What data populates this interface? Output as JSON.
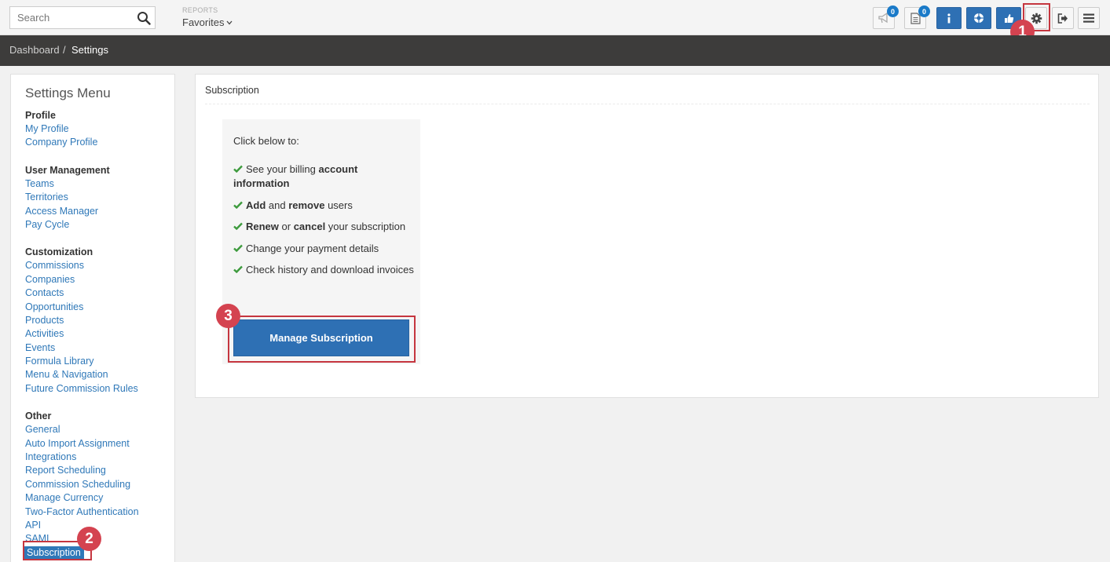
{
  "topbar": {
    "search_placeholder": "Search",
    "reports_label": "REPORTS",
    "favorites_label": "Favorites",
    "announcements_badge": "0",
    "documents_badge": "0"
  },
  "breadcrumb": {
    "items": [
      "Dashboard",
      "Settings"
    ],
    "separator": "/"
  },
  "sidebar": {
    "title": "Settings Menu",
    "sections": [
      {
        "heading": "Profile",
        "items": [
          "My Profile",
          "Company Profile"
        ]
      },
      {
        "heading": "User Management",
        "items": [
          "Teams",
          "Territories",
          "Access Manager",
          "Pay Cycle"
        ]
      },
      {
        "heading": "Customization",
        "items": [
          "Commissions",
          "Companies",
          "Contacts",
          "Opportunities",
          "Products",
          "Activities",
          "Events",
          "Formula Library",
          "Menu & Navigation",
          "Future Commission Rules"
        ]
      },
      {
        "heading": "Other",
        "items": [
          "General",
          "Auto Import Assignment",
          "Integrations",
          "Report Scheduling",
          "Commission Scheduling",
          "Manage Currency",
          "Two-Factor Authentication",
          "API",
          "SAML",
          "Subscription"
        ]
      }
    ],
    "active_item": "Subscription"
  },
  "main": {
    "panel_title": "Subscription",
    "intro": "Click below to:",
    "bullets": [
      {
        "pre": "See your billing ",
        "b1": "account information",
        "mid": "",
        "b2": "",
        "post": ""
      },
      {
        "pre": "",
        "b1": "Add",
        "mid": " and ",
        "b2": "remove",
        "post": " users"
      },
      {
        "pre": "",
        "b1": "Renew",
        "mid": " or ",
        "b2": "cancel",
        "post": " your subscription"
      },
      {
        "pre": "Change your payment details",
        "b1": "",
        "mid": "",
        "b2": "",
        "post": ""
      },
      {
        "pre": "Check history and download invoices",
        "b1": "",
        "mid": "",
        "b2": "",
        "post": ""
      }
    ],
    "manage_button": "Manage Subscription"
  },
  "annotations": {
    "step1": "1",
    "step2": "2",
    "step3": "3"
  },
  "colors": {
    "accent_blue": "#2e70b4",
    "link_blue": "#2f78b8",
    "highlight_red": "#c5363f",
    "marker_red": "#d44350",
    "check_green": "#3c9a3c",
    "crumb_bar": "#3d3c3b"
  },
  "icons": [
    "search-icon",
    "megaphone-icon",
    "document-icon",
    "info-icon",
    "lifebuoy-icon",
    "thumbs-up-icon",
    "gear-icon",
    "sign-out-icon",
    "hamburger-menu-icon",
    "check-icon",
    "chevron-down-icon"
  ]
}
